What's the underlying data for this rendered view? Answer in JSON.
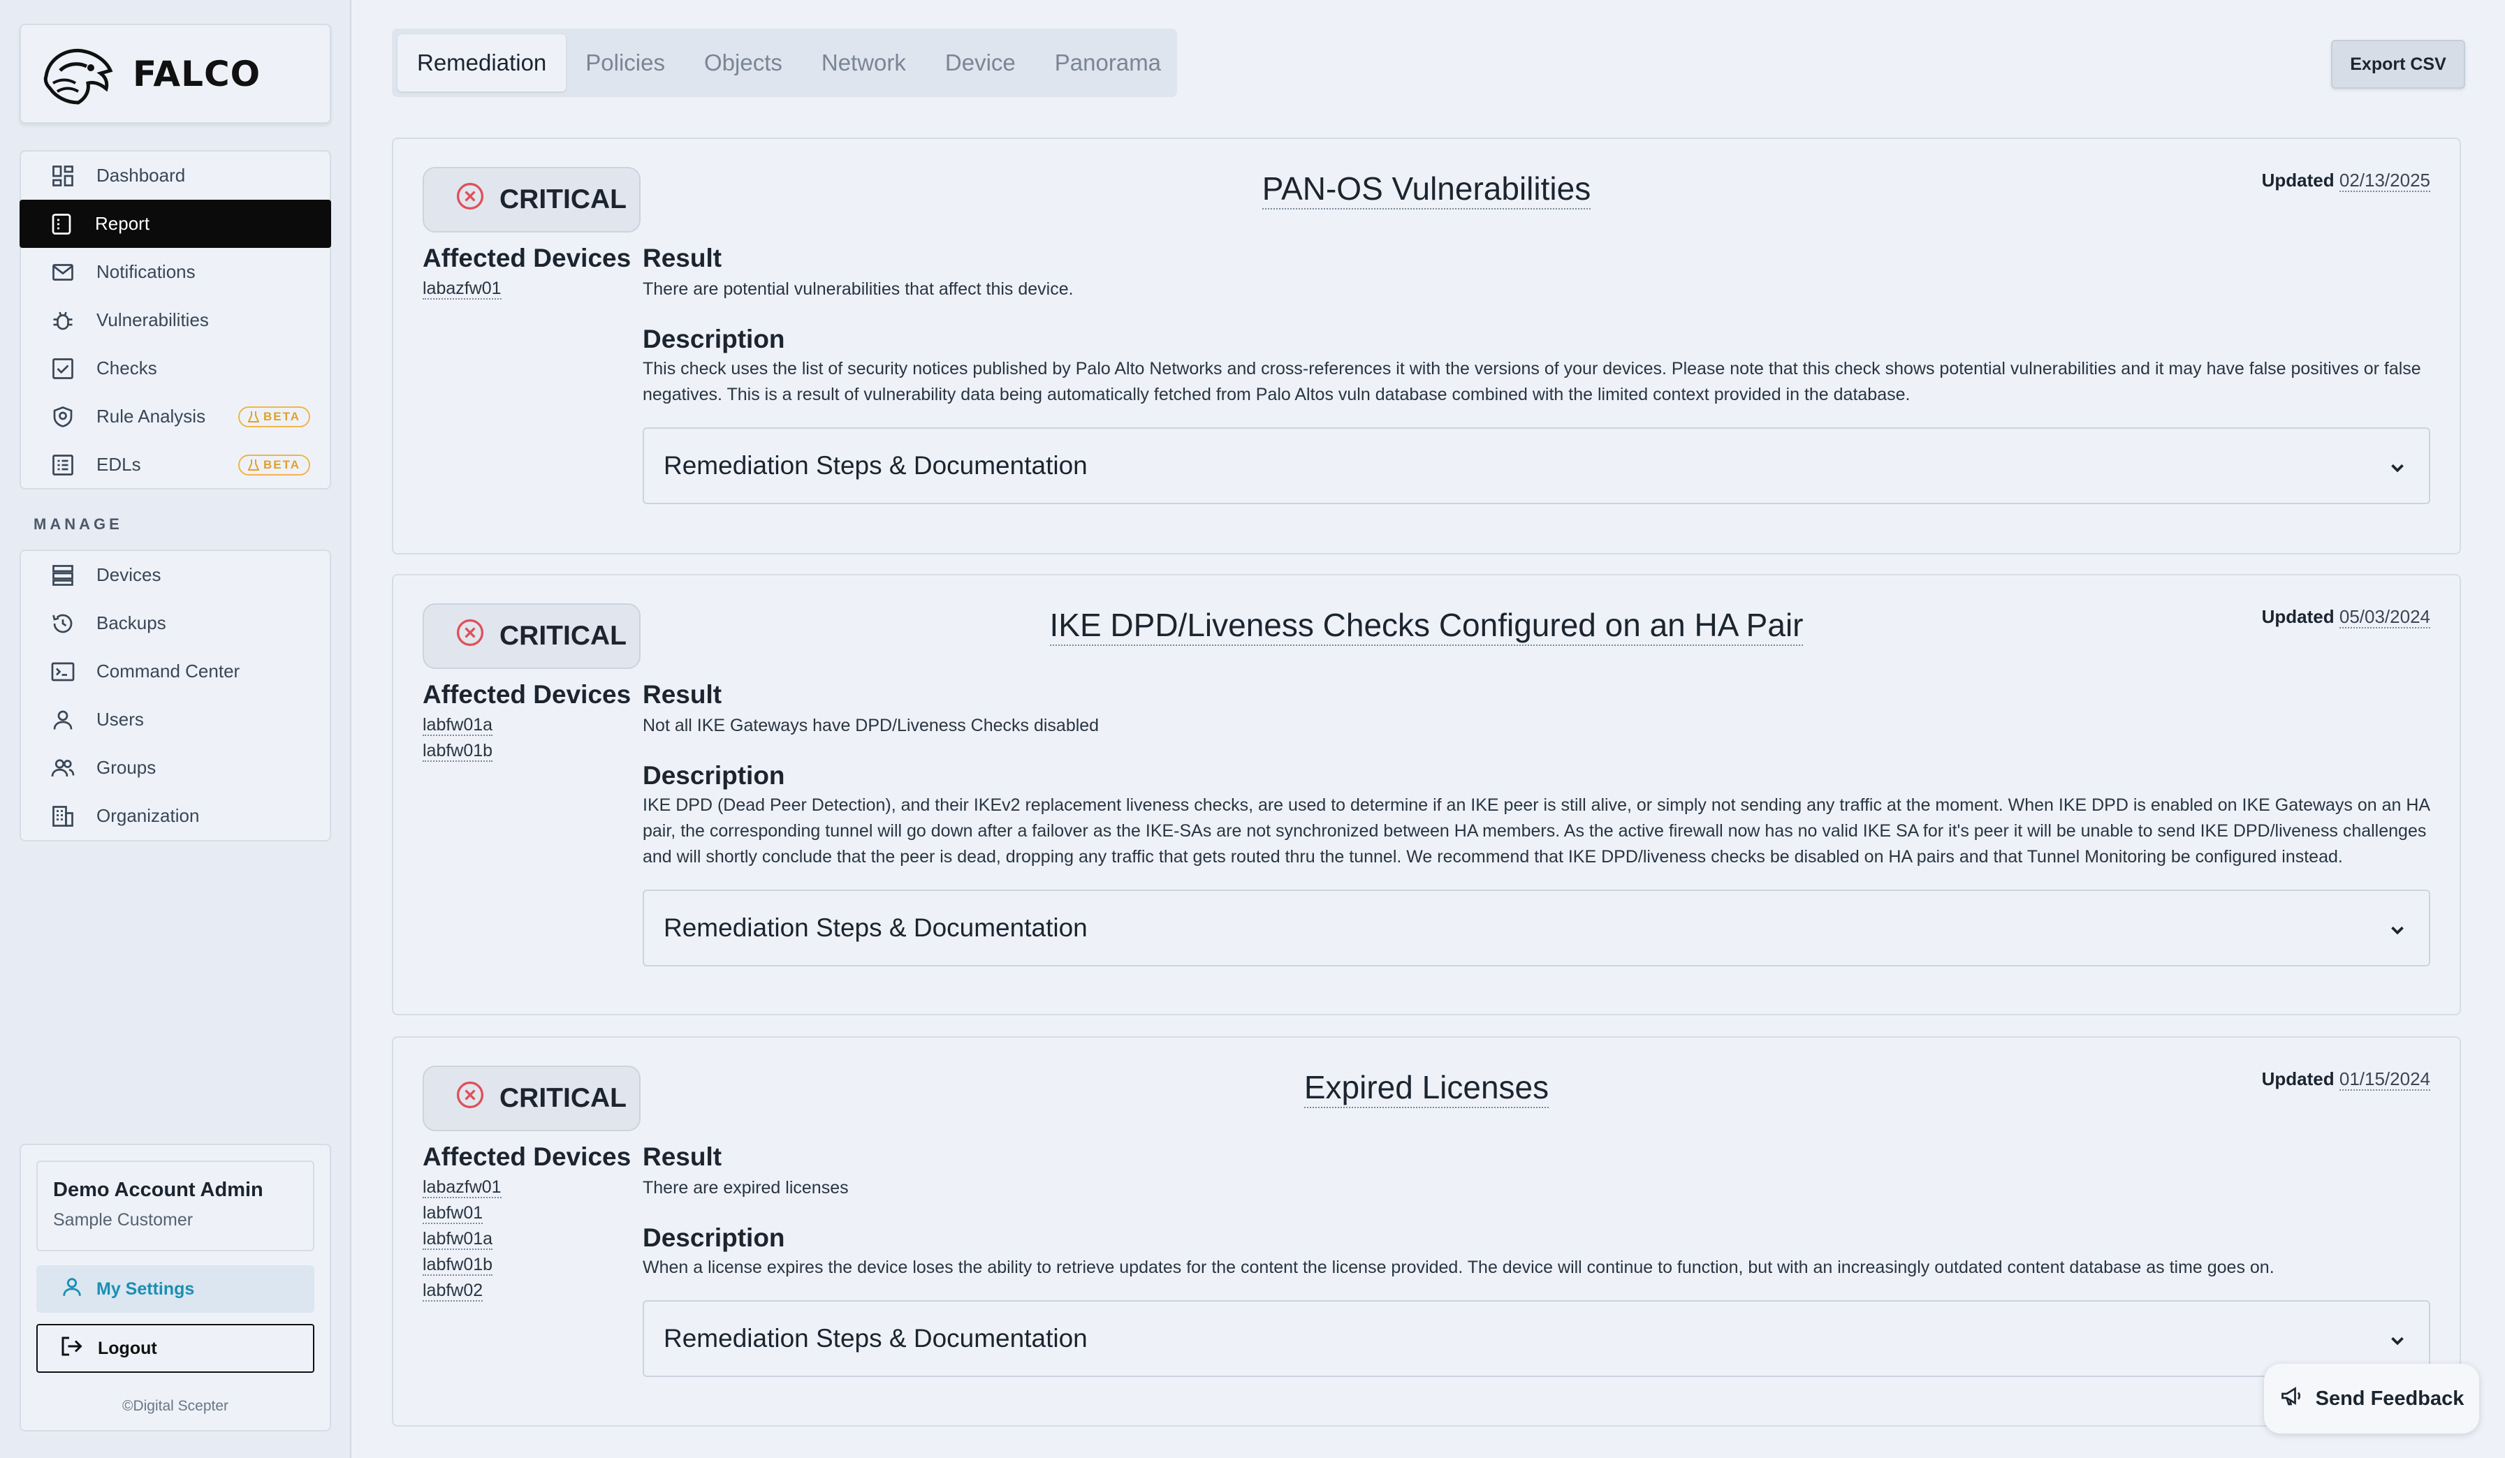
{
  "brand": {
    "name": "FALCO"
  },
  "nav": {
    "items": [
      {
        "label": "Dashboard",
        "icon": "dashboard-icon"
      },
      {
        "label": "Report",
        "icon": "report-icon",
        "active": true
      },
      {
        "label": "Notifications",
        "icon": "mail-icon"
      },
      {
        "label": "Vulnerabilities",
        "icon": "bug-icon"
      },
      {
        "label": "Checks",
        "icon": "checkbox-icon"
      },
      {
        "label": "Rule Analysis",
        "icon": "shield-icon",
        "badge": "BETA"
      },
      {
        "label": "EDLs",
        "icon": "list-icon",
        "badge": "BETA"
      }
    ]
  },
  "manage": {
    "label": "MANAGE",
    "items": [
      {
        "label": "Devices",
        "icon": "server-icon"
      },
      {
        "label": "Backups",
        "icon": "history-icon"
      },
      {
        "label": "Command Center",
        "icon": "terminal-icon"
      },
      {
        "label": "Users",
        "icon": "user-icon"
      },
      {
        "label": "Groups",
        "icon": "users-icon"
      },
      {
        "label": "Organization",
        "icon": "building-icon"
      }
    ]
  },
  "account": {
    "name": "Demo Account Admin",
    "org": "Sample Customer",
    "settings_label": "My Settings",
    "logout_label": "Logout",
    "copyright": "©Digital Scepter"
  },
  "tabs": [
    "Remediation",
    "Policies",
    "Objects",
    "Network",
    "Device",
    "Panorama"
  ],
  "export_label": "Export CSV",
  "labels": {
    "affected": "Affected Devices",
    "result": "Result",
    "description": "Description",
    "remediation": "Remediation Steps & Documentation",
    "updated": "Updated"
  },
  "cards": [
    {
      "severity": "CRITICAL",
      "title": "PAN-OS Vulnerabilities",
      "updated": "02/13/2025",
      "devices": [
        "labazfw01"
      ],
      "result": "There are potential vulnerabilities that affect this device.",
      "description": "This check uses the list of security notices published by Palo Alto Networks and cross-references it with the versions of your devices. Please note that this check shows potential vulnerabilities and it may have false positives or false negatives. This is a result of vulnerability data being automatically fetched from Palo Altos vuln database combined with the limited context provided in the database."
    },
    {
      "severity": "CRITICAL",
      "title": "IKE DPD/Liveness Checks Configured on an HA Pair",
      "updated": "05/03/2024",
      "devices": [
        "labfw01a",
        "labfw01b"
      ],
      "result": "Not all IKE Gateways have DPD/Liveness Checks disabled",
      "description": "IKE DPD (Dead Peer Detection), and their IKEv2 replacement liveness checks, are used to determine if an IKE peer is still alive, or simply not sending any traffic at the moment. When IKE DPD is enabled on IKE Gateways on an HA pair, the corresponding tunnel will go down after a failover as the IKE-SAs are not synchronized between HA members. As the active firewall now has no valid IKE SA for it's peer it will be unable to send IKE DPD/liveness challenges and will shortly conclude that the peer is dead, dropping any traffic that gets routed thru the tunnel. We recommend that IKE DPD/liveness checks be disabled on HA pairs and that Tunnel Monitoring be configured instead."
    },
    {
      "severity": "CRITICAL",
      "title": "Expired Licenses",
      "updated": "01/15/2024",
      "devices": [
        "labazfw01",
        "labfw01",
        "labfw01a",
        "labfw01b",
        "labfw02"
      ],
      "result": "There are expired licenses",
      "description": "When a license expires the device loses the ability to retrieve updates for the content the license provided. The device will continue to function, but with an increasingly outdated content database as time goes on."
    }
  ],
  "feedback_label": "Send Feedback"
}
